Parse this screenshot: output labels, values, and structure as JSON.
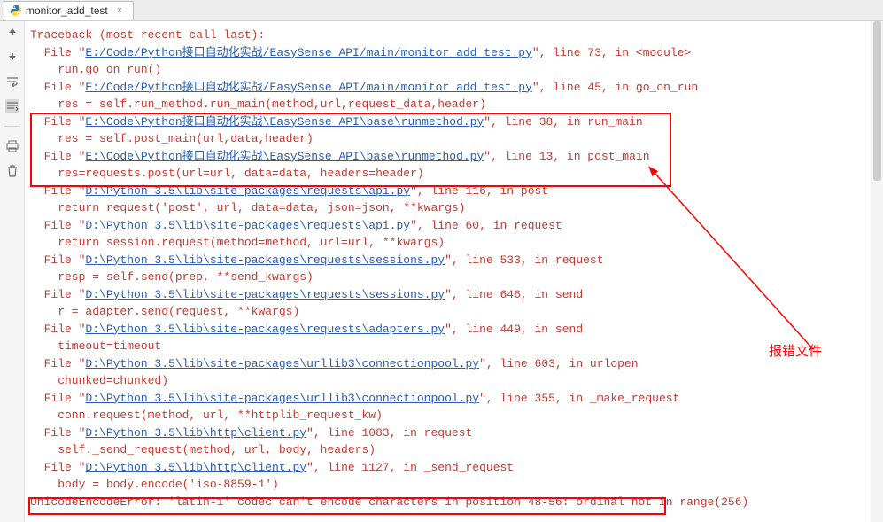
{
  "tab": {
    "label": "monitor_add_test",
    "close": "×"
  },
  "annotation": {
    "text": "报错文件"
  },
  "gutter_icons": [
    "arrow-up",
    "arrow-down",
    "soft-wrap",
    "scroll-to-end",
    "print",
    "trash"
  ],
  "trace": [
    {
      "indent": 0,
      "text": "Traceback (most recent call last):"
    },
    {
      "indent": 1,
      "prefix": "  File \"",
      "link": "E:/Code/Python接口自动化实战/EasySense_API/main/monitor_add_test.py",
      "suffix": "\", line 73, in <module>"
    },
    {
      "indent": 2,
      "text": "    run.go_on_run()"
    },
    {
      "indent": 1,
      "prefix": "  File \"",
      "link": "E:/Code/Python接口自动化实战/EasySense_API/main/monitor_add_test.py",
      "suffix": "\", line 45, in go_on_run"
    },
    {
      "indent": 2,
      "text": "    res = self.run_method.run_main(method,url,request_data,header)"
    },
    {
      "indent": 1,
      "prefix": "  File \"",
      "link": "E:\\Code\\Python接口自动化实战\\EasySense_API\\base\\runmethod.py",
      "suffix": "\", line 38, in run_main"
    },
    {
      "indent": 2,
      "text": "    res = self.post_main(url,data,header)"
    },
    {
      "indent": 1,
      "prefix": "  File \"",
      "link": "E:\\Code\\Python接口自动化实战\\EasySense_API\\base\\runmethod.py",
      "suffix": "\", line 13, in post_main"
    },
    {
      "indent": 2,
      "text": "    res=requests.post(url=url, data=data, headers=header)"
    },
    {
      "indent": 1,
      "prefix": "  File \"",
      "link": "D:\\Python 3.5\\lib\\site-packages\\requests\\api.py",
      "suffix": "\", line 116, in post"
    },
    {
      "indent": 2,
      "text": "    return request('post', url, data=data, json=json, **kwargs)"
    },
    {
      "indent": 1,
      "prefix": "  File \"",
      "link": "D:\\Python 3.5\\lib\\site-packages\\requests\\api.py",
      "suffix": "\", line 60, in request"
    },
    {
      "indent": 2,
      "text": "    return session.request(method=method, url=url, **kwargs)"
    },
    {
      "indent": 1,
      "prefix": "  File \"",
      "link": "D:\\Python 3.5\\lib\\site-packages\\requests\\sessions.py",
      "suffix": "\", line 533, in request"
    },
    {
      "indent": 2,
      "text": "    resp = self.send(prep, **send_kwargs)"
    },
    {
      "indent": 1,
      "prefix": "  File \"",
      "link": "D:\\Python 3.5\\lib\\site-packages\\requests\\sessions.py",
      "suffix": "\", line 646, in send"
    },
    {
      "indent": 2,
      "text": "    r = adapter.send(request, **kwargs)"
    },
    {
      "indent": 1,
      "prefix": "  File \"",
      "link": "D:\\Python 3.5\\lib\\site-packages\\requests\\adapters.py",
      "suffix": "\", line 449, in send"
    },
    {
      "indent": 2,
      "text": "    timeout=timeout"
    },
    {
      "indent": 1,
      "prefix": "  File \"",
      "link": "D:\\Python 3.5\\lib\\site-packages\\urllib3\\connectionpool.py",
      "suffix": "\", line 603, in urlopen"
    },
    {
      "indent": 2,
      "text": "    chunked=chunked)"
    },
    {
      "indent": 1,
      "prefix": "  File \"",
      "link": "D:\\Python 3.5\\lib\\site-packages\\urllib3\\connectionpool.py",
      "suffix": "\", line 355, in _make_request"
    },
    {
      "indent": 2,
      "text": "    conn.request(method, url, **httplib_request_kw)"
    },
    {
      "indent": 1,
      "prefix": "  File \"",
      "link": "D:\\Python 3.5\\lib\\http\\client.py",
      "suffix": "\", line 1083, in request"
    },
    {
      "indent": 2,
      "text": "    self._send_request(method, url, body, headers)"
    },
    {
      "indent": 1,
      "prefix": "  File \"",
      "link": "D:\\Python 3.5\\lib\\http\\client.py",
      "suffix": "\", line 1127, in _send_request"
    },
    {
      "indent": 2,
      "text": "    body = body.encode('iso-8859-1')"
    },
    {
      "indent": 0,
      "text": "UnicodeEncodeError: 'latin-1' codec can't encode characters in position 48-56: ordinal not in range(256)"
    }
  ]
}
